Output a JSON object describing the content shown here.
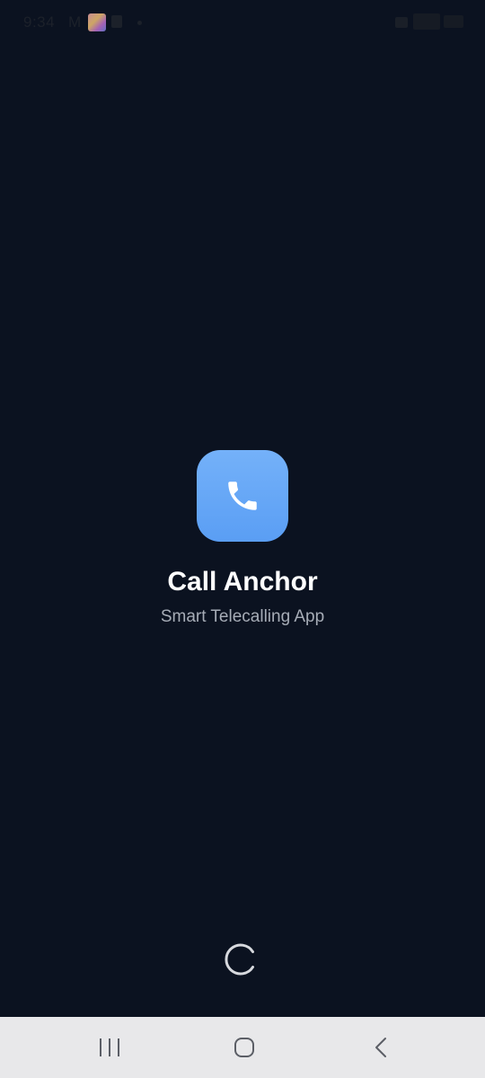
{
  "status_bar": {
    "time": "9:34",
    "carrier_icon": "M",
    "icons": [
      "app-thumbnail",
      "badge-icon",
      "dot",
      "wifi-icon",
      "signal-icon",
      "battery-icon"
    ]
  },
  "app": {
    "title": "Call Anchor",
    "subtitle": "Smart Telecalling App",
    "icon": "phone-icon",
    "icon_gradient": [
      "#74b1f9",
      "#5a9ef4"
    ]
  },
  "loading": {
    "indicator": "spinner"
  },
  "nav_bar": {
    "buttons": [
      "recents",
      "home",
      "back"
    ]
  },
  "colors": {
    "background": "#0b1220",
    "title": "#ffffff",
    "subtitle": "#a6acb6",
    "nav_bar": "#e8e8ea"
  }
}
